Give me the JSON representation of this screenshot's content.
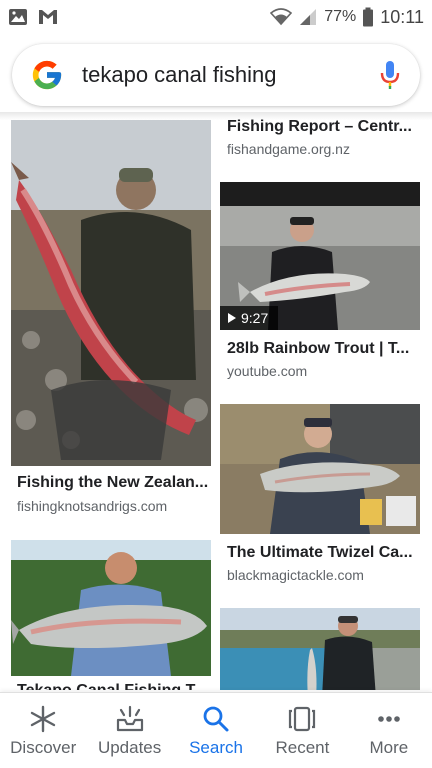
{
  "status_bar": {
    "battery_percent": "77%",
    "time": "10:11",
    "left_icons": [
      "gallery-icon",
      "gmail-icon"
    ],
    "right_icons": [
      "wifi-icon",
      "signal-icon",
      "battery-icon"
    ]
  },
  "search": {
    "query": "tekapo canal fishing",
    "logo": "google-g-icon",
    "mic": "mic-icon"
  },
  "results": [
    {
      "title": "Fishing Report – Centr...",
      "source": "fishandgame.org.nz"
    },
    {
      "title": "Fishing the New Zealan...",
      "source": "fishingknotsandrigs.com"
    },
    {
      "title": "28lb Rainbow Trout | T...",
      "source": "youtube.com",
      "duration": "9:27"
    },
    {
      "title": "The Ultimate Twizel Ca...",
      "source": "blackmagictackle.com"
    },
    {
      "title": "Tekapo Canal Fishing T...",
      "source": ""
    }
  ],
  "bottom_nav": [
    {
      "label": "Discover",
      "icon": "asterisk-icon",
      "active": false
    },
    {
      "label": "Updates",
      "icon": "updates-tray-icon",
      "active": false
    },
    {
      "label": "Search",
      "icon": "search-icon",
      "active": true
    },
    {
      "label": "Recent",
      "icon": "recent-tabs-icon",
      "active": false
    },
    {
      "label": "More",
      "icon": "more-dots-icon",
      "active": false
    }
  ],
  "colors": {
    "accent": "#1a73e8",
    "text_primary": "#202124",
    "text_secondary": "#5f6368"
  }
}
